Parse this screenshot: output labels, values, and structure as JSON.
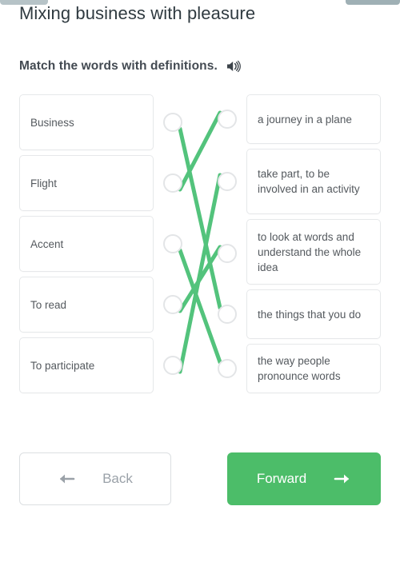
{
  "window": {
    "chrome_tabs": [
      "",
      ""
    ]
  },
  "header": {
    "title": "Mixing business with pleasure",
    "instruction": "Match the words with definitions.",
    "speaker_icon": "speaker-audio-icon"
  },
  "exercise": {
    "type": "match-the-pairs",
    "left_column": [
      {
        "id": "L1",
        "label": "Business"
      },
      {
        "id": "L2",
        "label": "Flight"
      },
      {
        "id": "L3",
        "label": "Accent"
      },
      {
        "id": "L4",
        "label": "To read"
      },
      {
        "id": "L5",
        "label": "To participate"
      }
    ],
    "right_column": [
      {
        "id": "R1",
        "label": "a journey in a plane"
      },
      {
        "id": "R2",
        "label": "take part, to be involved in an activity"
      },
      {
        "id": "R3",
        "label": "to look at words and understand the whole idea"
      },
      {
        "id": "R4",
        "label": "the things that you do"
      },
      {
        "id": "R5",
        "label": "the way people pronounce words"
      }
    ],
    "connections": [
      {
        "from": "L1",
        "to": "R4"
      },
      {
        "from": "L2",
        "to": "R1"
      },
      {
        "from": "L3",
        "to": "R5"
      },
      {
        "from": "L4",
        "to": "R3"
      },
      {
        "from": "L5",
        "to": "R2"
      }
    ],
    "line_color": "#53c37c",
    "node_fill": "#ffffff",
    "node_border": "#e3e5e7"
  },
  "footer": {
    "back_label": "Back",
    "back_icon": "arrow-left-icon",
    "forward_label": "Forward",
    "forward_icon": "arrow-right-icon",
    "forward_color": "#4cbd69"
  }
}
